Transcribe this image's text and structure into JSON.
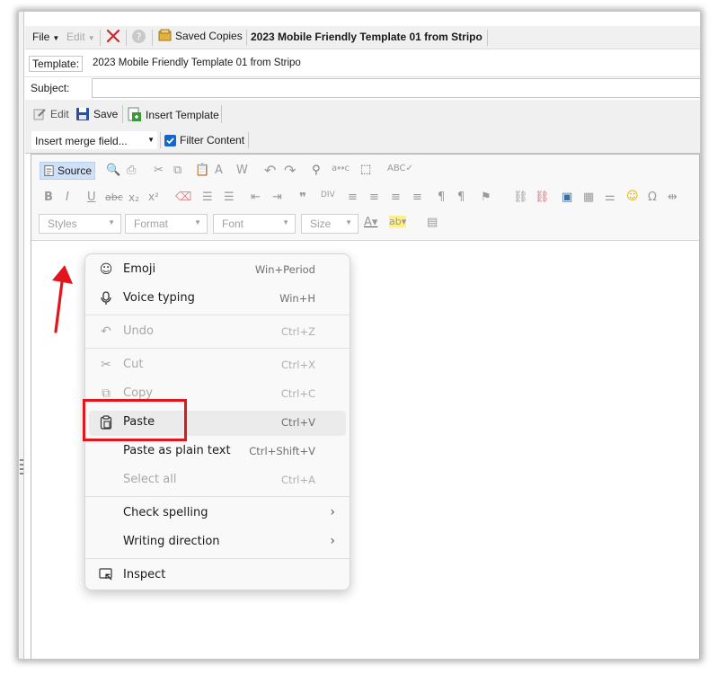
{
  "menubar": {
    "file": "File",
    "edit": "Edit",
    "saved_copies": "Saved Copies",
    "document_title": "2023 Mobile Friendly Template 01 from Stripo"
  },
  "form": {
    "template_label": "Template:",
    "template_value": "2023 Mobile Friendly Template 01 from Stripo",
    "subject_label": "Subject:",
    "subject_value": ""
  },
  "toolbar": {
    "edit": "Edit",
    "save": "Save",
    "insert_template": "Insert Template",
    "merge_field": "Insert merge field...",
    "filter_content": "Filter Content",
    "filter_checked": true
  },
  "editor_toolbar": {
    "source": "Source",
    "styles": "Styles",
    "format": "Format",
    "font": "Font",
    "size": "Size",
    "bold": "B",
    "italic": "I",
    "underline": "U",
    "strike": "abc",
    "subscript": "x₂",
    "superscript": "x²"
  },
  "context_menu": {
    "items": [
      {
        "label": "Emoji",
        "shortcut": "Win+Period",
        "icon": "emoji-icon",
        "enabled": true
      },
      {
        "label": "Voice typing",
        "shortcut": "Win+H",
        "icon": "microphone-icon",
        "enabled": true
      },
      {
        "label": "Undo",
        "shortcut": "Ctrl+Z",
        "icon": "undo-icon",
        "enabled": false
      },
      {
        "label": "Cut",
        "shortcut": "Ctrl+X",
        "icon": "scissors-icon",
        "enabled": false
      },
      {
        "label": "Copy",
        "shortcut": "Ctrl+C",
        "icon": "copy-icon",
        "enabled": false
      },
      {
        "label": "Paste",
        "shortcut": "Ctrl+V",
        "icon": "clipboard-icon",
        "enabled": true
      },
      {
        "label": "Paste as plain text",
        "shortcut": "Ctrl+Shift+V",
        "icon": "",
        "enabled": true
      },
      {
        "label": "Select all",
        "shortcut": "Ctrl+A",
        "icon": "",
        "enabled": false
      },
      {
        "label": "Check spelling",
        "shortcut": "",
        "icon": "",
        "enabled": true
      },
      {
        "label": "Writing direction",
        "shortcut": "",
        "icon": "",
        "enabled": true
      },
      {
        "label": "Inspect",
        "shortcut": "",
        "icon": "inspect-icon",
        "enabled": true
      }
    ]
  },
  "colors": {
    "accent_red": "#e3141b",
    "checkbox_blue": "#1466c9",
    "source_highlight": "#cfe0f7"
  }
}
